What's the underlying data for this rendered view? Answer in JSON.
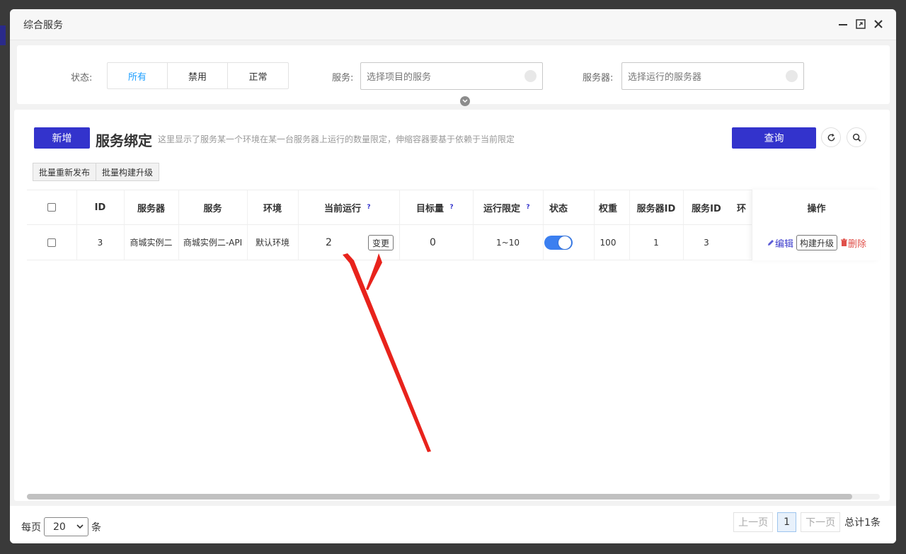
{
  "window": {
    "title": "综合服务"
  },
  "filters": {
    "status_label": "状态:",
    "status_options": [
      "所有",
      "禁用",
      "正常"
    ],
    "service_label": "服务:",
    "service_placeholder": "选择项目的服务",
    "server_label": "服务器:",
    "server_placeholder": "选择运行的服务器"
  },
  "toolbar": {
    "add_label": "新增",
    "title": "服务绑定",
    "description": "这里显示了服务某一个环境在某一台服务器上运行的数量限定，伸缩容器要基于依赖于当前限定",
    "query_label": "查询",
    "batch_redeploy_label": "批量重新发布",
    "batch_build_label": "批量构建升级"
  },
  "table": {
    "headers": {
      "id": "ID",
      "server": "服务器",
      "service": "服务",
      "env": "环境",
      "current_running": "当前运行",
      "target": "目标量",
      "limit": "运行限定",
      "status": "状态",
      "weight": "权重",
      "server_id": "服务器ID",
      "service_id": "服务ID",
      "env_cut": "环",
      "ops": "操作",
      "help_mark": "?"
    },
    "rows": [
      {
        "id": "3",
        "server": "商城实例二",
        "service": "商城实例二-API",
        "env": "默认环境",
        "current_running": "2",
        "change_label": "变更",
        "target": "0",
        "limit": "1~10",
        "status_on": true,
        "weight": "100",
        "server_id": "1",
        "service_id": "3",
        "edit_label": "编辑",
        "build_label": "构建升级",
        "delete_label": "删除"
      }
    ]
  },
  "pagination": {
    "per_page_prefix": "每页",
    "per_page_value": "20",
    "per_page_suffix": "条",
    "prev_label": "上一页",
    "current_page": "1",
    "next_label": "下一页",
    "total_label": "总计1条"
  },
  "colors": {
    "primary": "#3333cc",
    "active_tab": "#1e9fff",
    "switch_on": "#3b7ff0",
    "delete": "#e0504a",
    "annotation_arrow": "#e8231c"
  },
  "icons": {
    "minimize": "minimize-icon",
    "maximize": "maximize-icon",
    "close": "close-icon",
    "refresh": "refresh-icon",
    "search": "search-icon",
    "edit": "pencil-icon",
    "delete": "trash-icon"
  }
}
